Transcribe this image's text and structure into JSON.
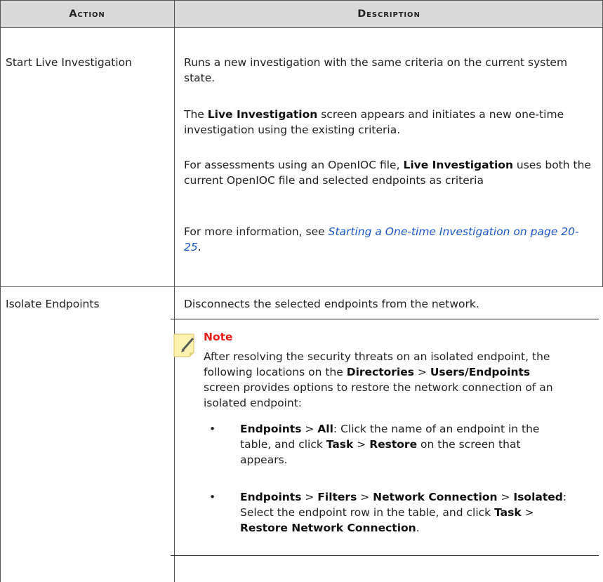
{
  "header": {
    "action": "Action",
    "description": "Description"
  },
  "rows": [
    {
      "action": "Start Live Investigation",
      "p1": "Runs a new investigation with the same criteria on the current system state.",
      "p2a": "The ",
      "p2b": "Live Investigation",
      "p2c": " screen appears and initiates a new one-time investigation using the existing criteria.",
      "p3a": "For assessments using an OpenIOC file, ",
      "p3b": "Live Investigation",
      "p3c": " uses both the current OpenIOC file and selected endpoints as criteria",
      "p4a": "For more information, see ",
      "p4link": "Starting a One-time Investigation on page 20-25",
      "p4c": "."
    },
    {
      "action": "Isolate Endpoints",
      "p1": "Disconnects the selected endpoints from the network.",
      "note": {
        "title": "Note",
        "t1": "After resolving the security threats on an isolated endpoint, the following locations on the ",
        "t2": "Directories",
        "t3": " > ",
        "t4": "Users/Endpoints",
        "t5": " screen provides options to restore the network connection of an isolated endpoint:",
        "bullets": [
          {
            "a": "Endpoints",
            "b": " > ",
            "c": "All",
            "d": ": Click the name of an endpoint in the table, and click ",
            "e": "Task",
            "f": " > ",
            "g": "Restore",
            "h": " on the screen that appears."
          },
          {
            "a": "Endpoints",
            "b": " > ",
            "c": "Filters",
            "d": " > ",
            "e": "Network Connection",
            "f": " > ",
            "g": "Isolated",
            "h": ": Select the endpoint row in the table, and click ",
            "i": "Task",
            "j": " > ",
            "k": "Restore Network Connection",
            "l": "."
          }
        ]
      }
    }
  ]
}
